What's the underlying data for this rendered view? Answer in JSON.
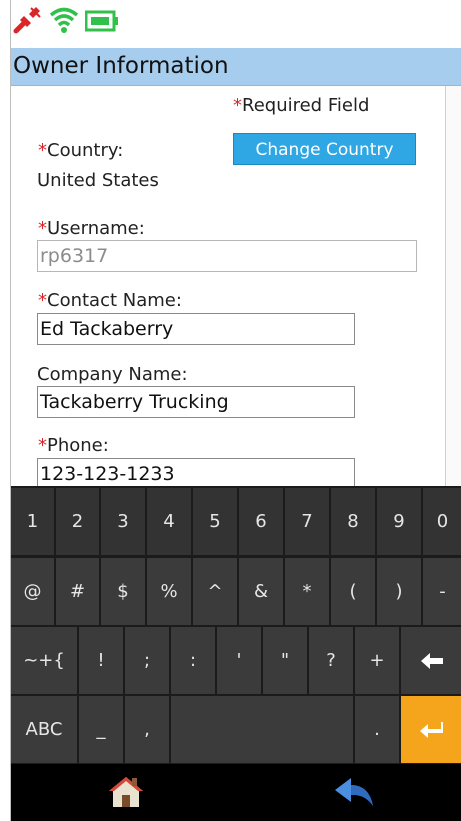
{
  "status_bar": {
    "icons": [
      "plug-disconnected-icon",
      "wifi-icon",
      "battery-icon"
    ],
    "colors": {
      "wifi": "#31c04a",
      "battery": "#31c04a",
      "plug": "#d9262a"
    }
  },
  "title_bar": {
    "title": "Owner Information",
    "color": "#a6cdee"
  },
  "form": {
    "required_asterisk": "*",
    "required_note": "Required Field",
    "country": {
      "label": "Country:",
      "value": "United States",
      "button": "Change Country"
    },
    "username": {
      "label": "Username:",
      "value": "rp6317"
    },
    "contact_name": {
      "label": "Contact Name:",
      "value": "Ed Tackaberry"
    },
    "company_name": {
      "label": "Company Name:",
      "value": "Tackaberry Trucking"
    },
    "phone": {
      "label": "Phone:",
      "value": "123-123-1233"
    }
  },
  "keyboard": {
    "row1": [
      "1",
      "2",
      "3",
      "4",
      "5",
      "6",
      "7",
      "8",
      "9",
      "0"
    ],
    "row2": [
      "@",
      "#",
      "$",
      "%",
      "^",
      "&",
      "*",
      "(",
      ")",
      "-"
    ],
    "row3": [
      "~+{",
      "!",
      ";",
      ":",
      "'",
      "\"",
      "?",
      "+"
    ],
    "row4": {
      "abc": "ABC",
      "underscore": "_",
      "comma": ",",
      "period": "."
    },
    "icons": [
      "backspace-icon",
      "enter-icon"
    ],
    "colors": {
      "enter": "#f5a51c",
      "key": "#3b3b3b"
    }
  },
  "nav_bar": {
    "icons": [
      "home-icon",
      "back-icon"
    ]
  }
}
